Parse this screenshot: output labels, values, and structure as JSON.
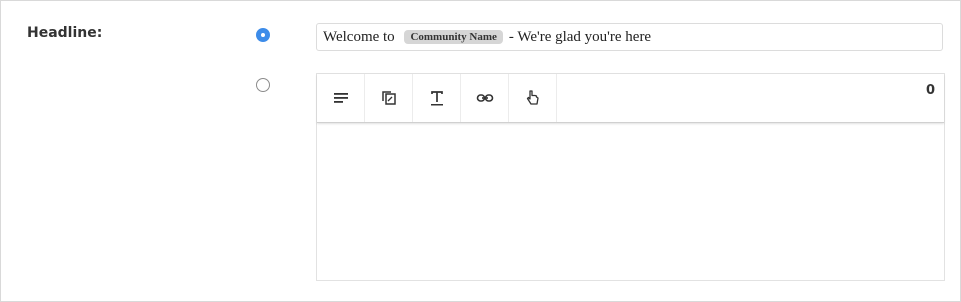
{
  "headline": {
    "label": "Headline:",
    "option_text": {
      "selected": true,
      "prefix": "Welcome to ",
      "token": "Community Name",
      "suffix": "- We're glad you're here"
    },
    "option_rich": {
      "selected": false,
      "char_count": "0",
      "toolbar": [
        {
          "icon": "align-icon"
        },
        {
          "icon": "copy-format-icon"
        },
        {
          "icon": "text-format-icon"
        },
        {
          "icon": "link-icon"
        },
        {
          "icon": "hand-pointer-icon"
        }
      ],
      "body": ""
    }
  },
  "colors": {
    "accent": "#3d8ce9",
    "border": "#dcdcdc"
  }
}
